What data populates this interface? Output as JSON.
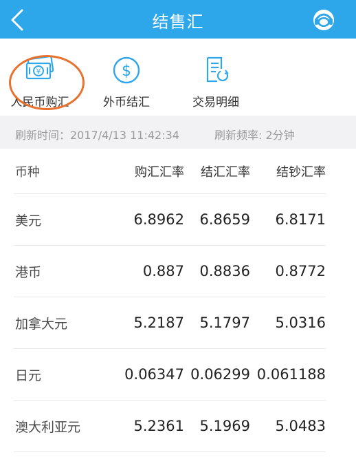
{
  "header": {
    "title": "结售汇",
    "back_icon": "chevron-left-icon",
    "service_icon": "customer-service-icon",
    "bg_color": "#2ea7ea"
  },
  "actions": [
    {
      "label": "人民币购汇",
      "icon": "rmb-exchange-icon"
    },
    {
      "label": "外币结汇",
      "icon": "dollar-coin-icon"
    },
    {
      "label": "交易明细",
      "icon": "transaction-detail-icon"
    }
  ],
  "highlight_color": "#e8712d",
  "refresh": {
    "time_text": "刷新时间：2017/4/13 11:42:34",
    "freq_text": "刷新频率: 2分钟"
  },
  "table": {
    "headers": [
      "币种",
      "购汇汇率",
      "结汇汇率",
      "结钞汇率"
    ],
    "rows": [
      {
        "currency": "美元",
        "buy": "6.8962",
        "settle": "6.8659",
        "cash": "6.8171"
      },
      {
        "currency": "港币",
        "buy": "0.887",
        "settle": "0.8836",
        "cash": "0.8772"
      },
      {
        "currency": "加拿大元",
        "buy": "5.2187",
        "settle": "5.1797",
        "cash": "5.0316"
      },
      {
        "currency": "日元",
        "buy": "0.06347",
        "settle": "0.06299",
        "cash": "0.061188"
      },
      {
        "currency": "澳大利亚元",
        "buy": "5.2361",
        "settle": "5.1969",
        "cash": "5.0483"
      }
    ]
  }
}
